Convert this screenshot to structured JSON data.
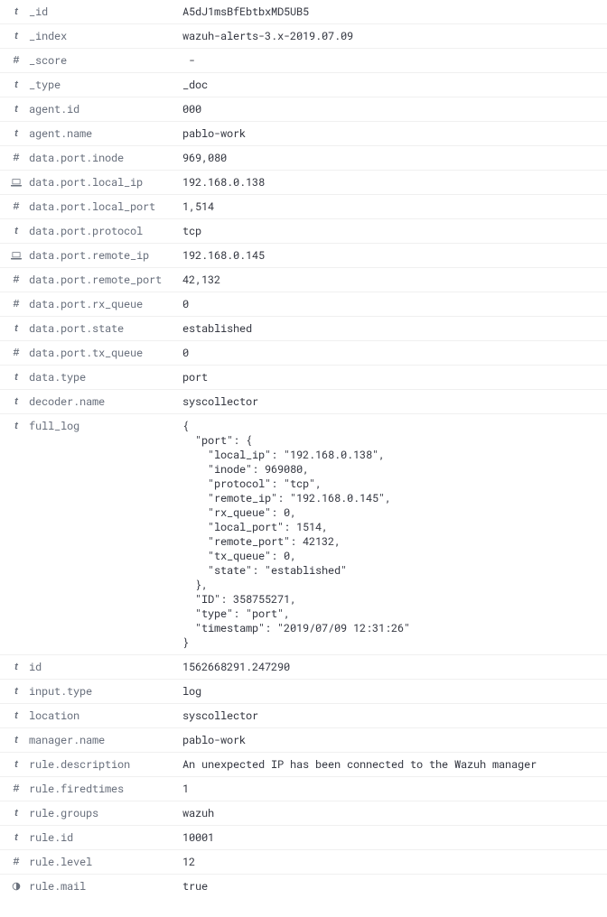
{
  "icons": {
    "text": "t",
    "number": "#"
  },
  "fields": [
    {
      "type": "text",
      "name": "_id",
      "value": "A5dJ1msBfEbtbxMD5UB5"
    },
    {
      "type": "text",
      "name": "_index",
      "value": "wazuh-alerts-3.x-2019.07.09"
    },
    {
      "type": "number",
      "name": "_score",
      "value": " -"
    },
    {
      "type": "text",
      "name": "_type",
      "value": "_doc"
    },
    {
      "type": "text",
      "name": "agent.id",
      "value": "000"
    },
    {
      "type": "text",
      "name": "agent.name",
      "value": "pablo-work"
    },
    {
      "type": "number",
      "name": "data.port.inode",
      "value": "969,080"
    },
    {
      "type": "ip",
      "name": "data.port.local_ip",
      "value": "192.168.0.138"
    },
    {
      "type": "number",
      "name": "data.port.local_port",
      "value": "1,514"
    },
    {
      "type": "text",
      "name": "data.port.protocol",
      "value": "tcp"
    },
    {
      "type": "ip",
      "name": "data.port.remote_ip",
      "value": "192.168.0.145"
    },
    {
      "type": "number",
      "name": "data.port.remote_port",
      "value": "42,132"
    },
    {
      "type": "number",
      "name": "data.port.rx_queue",
      "value": "0"
    },
    {
      "type": "text",
      "name": "data.port.state",
      "value": "established"
    },
    {
      "type": "number",
      "name": "data.port.tx_queue",
      "value": "0"
    },
    {
      "type": "text",
      "name": "data.type",
      "value": "port"
    },
    {
      "type": "text",
      "name": "decoder.name",
      "value": "syscollector"
    },
    {
      "type": "text",
      "name": "full_log",
      "value": "{\n  \"port\": {\n    \"local_ip\": \"192.168.0.138\",\n    \"inode\": 969080,\n    \"protocol\": \"tcp\",\n    \"remote_ip\": \"192.168.0.145\",\n    \"rx_queue\": 0,\n    \"local_port\": 1514,\n    \"remote_port\": 42132,\n    \"tx_queue\": 0,\n    \"state\": \"established\"\n  },\n  \"ID\": 358755271,\n  \"type\": \"port\",\n  \"timestamp\": \"2019/07/09 12:31:26\"\n}"
    },
    {
      "type": "text",
      "name": "id",
      "value": "1562668291.247290"
    },
    {
      "type": "text",
      "name": "input.type",
      "value": "log"
    },
    {
      "type": "text",
      "name": "location",
      "value": "syscollector"
    },
    {
      "type": "text",
      "name": "manager.name",
      "value": "pablo-work"
    },
    {
      "type": "text",
      "name": "rule.description",
      "value": "An unexpected IP has been connected to the Wazuh manager"
    },
    {
      "type": "number",
      "name": "rule.firedtimes",
      "value": "1"
    },
    {
      "type": "text",
      "name": "rule.groups",
      "value": "wazuh"
    },
    {
      "type": "text",
      "name": "rule.id",
      "value": "10001"
    },
    {
      "type": "number",
      "name": "rule.level",
      "value": "12"
    },
    {
      "type": "bool",
      "name": "rule.mail",
      "value": "true"
    }
  ]
}
